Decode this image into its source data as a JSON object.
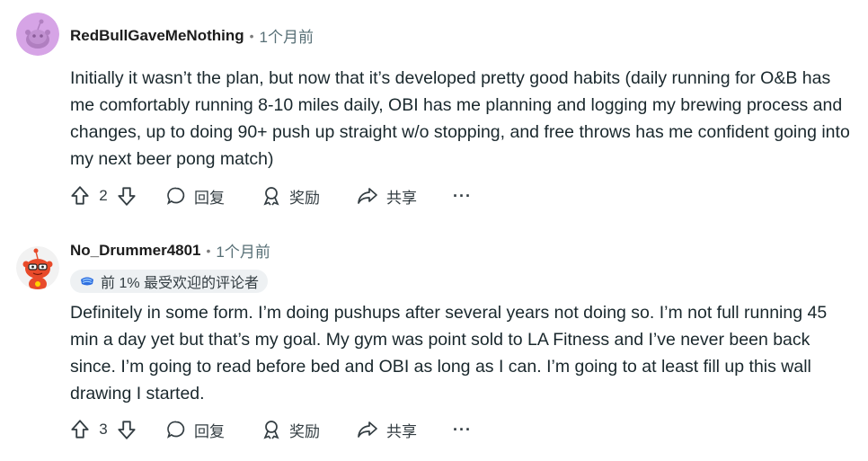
{
  "comments": [
    {
      "username": "RedBullGaveMeNothing",
      "time": "1个月前",
      "flair": null,
      "body": "Initially it wasn’t the plan, but now that it’s developed pretty good habits (daily running for O&B has me comfortably running 8-10 miles daily, OBI has me planning and logging my brewing process and changes, up to doing 90+ push up straight w/o stopping, and free throws has me confident going into my next beer pong match)",
      "votes": "2",
      "reply_label": "回复",
      "award_label": "奖励",
      "share_label": "共享",
      "more_label": "···",
      "avatar_color": "#d6a4e6"
    },
    {
      "username": "No_Drummer4801",
      "time": "1个月前",
      "flair": "前 1% 最受欢迎的评论者",
      "body": "Definitely in some form. I’m doing pushups after several years not doing so. I’m not full running 45 min a day yet but that’s my goal. My gym was point sold to LA Fitness and I’ve never been back since. I’m going to read before bed and OBI as long as I can. I’m going to at least fill up this wall drawing I started.",
      "votes": "3",
      "reply_label": "回复",
      "award_label": "奖励",
      "share_label": "共享",
      "more_label": "···",
      "avatar_color": "#e84a2a"
    }
  ],
  "icons": {
    "upvote": "arrow-up-icon",
    "downvote": "arrow-down-icon",
    "reply": "speech-bubble-icon",
    "award": "award-icon",
    "share": "share-arrow-icon",
    "flair": "top-commenter-badge-icon"
  }
}
